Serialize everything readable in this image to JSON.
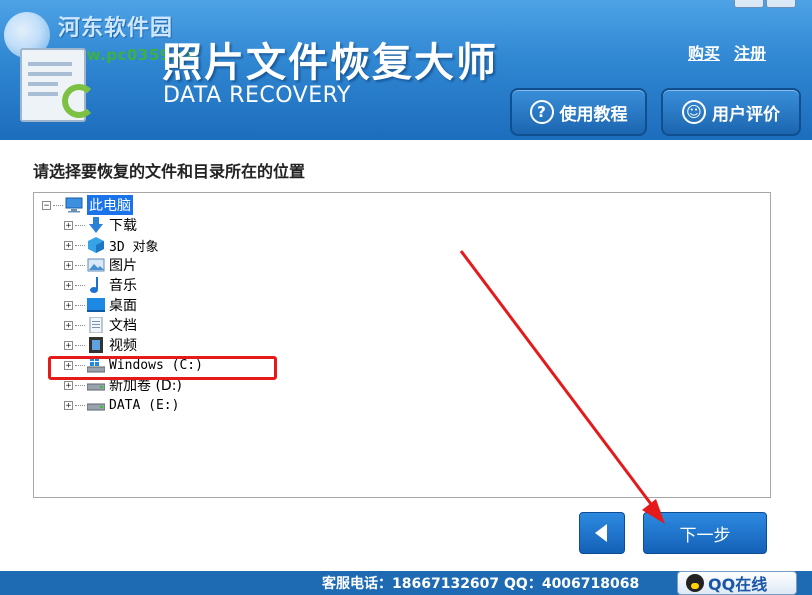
{
  "watermark": {
    "site_name": "河东软件园",
    "url": "www.pc0359.cn"
  },
  "app": {
    "title": "照片文件恢复大师",
    "subtitle": "DATA RECOVERY"
  },
  "header_links": {
    "buy": "购买",
    "register": "注册"
  },
  "header_buttons": {
    "tutorial": "使用教程",
    "review": "用户评价"
  },
  "prompt": "请选择要恢复的文件和目录所在的位置",
  "tree": {
    "root": "此电脑",
    "items": [
      {
        "label": "下载",
        "icon": "download-arrow-icon"
      },
      {
        "label": "3D 对象",
        "icon": "3d-objects-icon"
      },
      {
        "label": "图片",
        "icon": "pictures-icon"
      },
      {
        "label": "音乐",
        "icon": "music-note-icon"
      },
      {
        "label": "桌面",
        "icon": "desktop-icon"
      },
      {
        "label": "文档",
        "icon": "document-icon"
      },
      {
        "label": "视频",
        "icon": "video-icon"
      },
      {
        "label": "Windows (C:)",
        "icon": "windows-drive-icon"
      },
      {
        "label": "新加卷 (D:)",
        "icon": "drive-icon"
      },
      {
        "label": "DATA (E:)",
        "icon": "drive-icon"
      }
    ]
  },
  "nav": {
    "next": "下一步"
  },
  "footer": {
    "contact": "客服电话：18667132607 QQ：4006718068",
    "qq_online": "QQ在线"
  },
  "colors": {
    "header_blue": "#2f86d1",
    "highlight_red": "#e51b1b",
    "button_blue": "#1f73c9"
  }
}
